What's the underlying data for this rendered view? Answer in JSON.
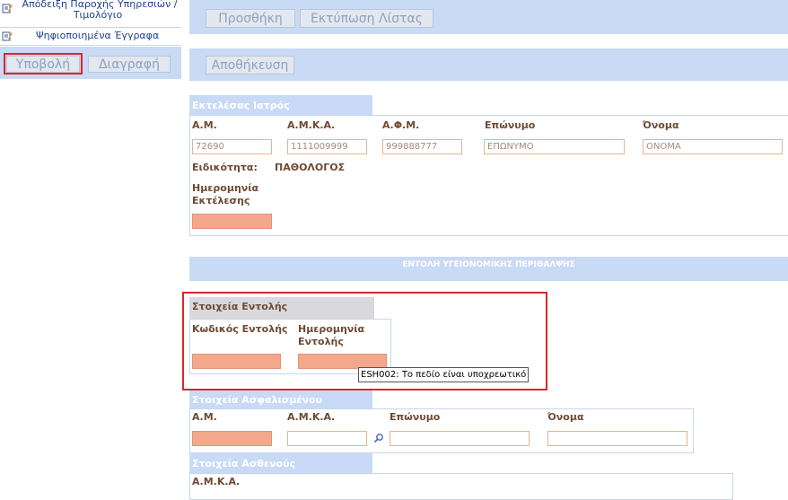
{
  "sidebar": {
    "items": [
      {
        "label_line1": "Απόδειξη Παροχής Υπηρεσιών /",
        "label_line2": "Τιμολόγιο",
        "icon": "edit-document-icon"
      },
      {
        "label": "Ψηφιοποιημένα Έγγραφα",
        "icon": "edit-document-icon"
      }
    ],
    "submit_label": "Υποβολή",
    "delete_label": "Διαγραφή"
  },
  "toolbar": {
    "add_label": "Προσθήκη",
    "print_list_label": "Εκτύπωση Λίστας",
    "save_label": "Αποθήκευση"
  },
  "executor": {
    "section_title": "Εκτελέσας Ιατρός",
    "am_label": "Α.Μ.",
    "amka_label": "Α.Μ.Κ.Α.",
    "afm_label": "Α.Φ.Μ.",
    "surname_label": "Επώνυμο",
    "name_label": "Όνομα",
    "am_value": "72690",
    "amka_value": "1111009999",
    "afm_value": "999888777",
    "surname_value": "ΕΠΩΝΥΜΟ",
    "name_value": "ΟΝΟΜΑ",
    "specialty_label": "Ειδικότητα:",
    "specialty_value": "ΠΑΘΟΛΟΓΟΣ",
    "exec_date_label_line1": "Ημερομηνία",
    "exec_date_label_line2": "Εκτέλεσης",
    "exec_date_value": ""
  },
  "prescription_banner": "ΕΝΤΟΛΗ ΥΓΕΙΟΝΟΜΙΚΗΣ ΠΕΡΙΘΑΛΨΗΣ",
  "order": {
    "section_title": "Στοιχεία Εντολής",
    "code_label": "Κωδικός Εντολής",
    "date_label_line1": "Ημερομηνία",
    "date_label_line2": "Εντολής",
    "code_value": "",
    "date_value": "",
    "tooltip": "ESH002: Το πεδίο είναι υποχρεωτικό"
  },
  "insured": {
    "section_title": "Στοιχεία Ασφαλισμένου",
    "am_label": "Α.Μ.",
    "amka_label": "Α.Μ.Κ.Α.",
    "surname_label": "Επώνυμο",
    "name_label": "Όνομα"
  },
  "patient": {
    "section_title": "Στοιχεία Ασθενούς",
    "amka_label": "Α.Μ.Κ.Α."
  },
  "colors": {
    "required_field": "#f3a88c",
    "highlight_border": "#d9262c",
    "band": "#c9daf4"
  }
}
